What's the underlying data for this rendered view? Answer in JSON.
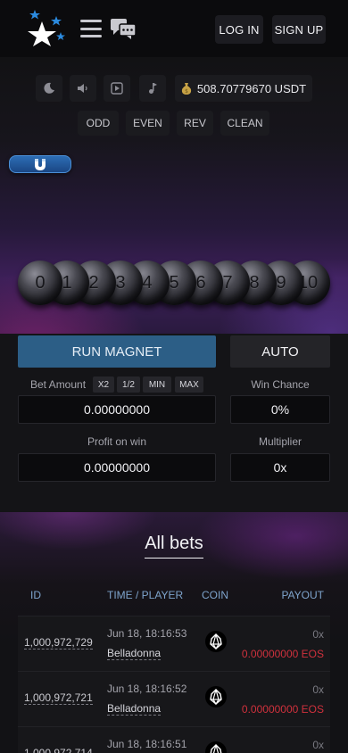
{
  "header": {
    "login_label": "LOG IN",
    "signup_label": "SIGN UP",
    "logo_icon": "stars-logo-icon",
    "menu_icon": "hamburger-icon",
    "chat_icon": "chat-bubbles-icon"
  },
  "game": {
    "controls": [
      {
        "name": "moon-icon"
      },
      {
        "name": "volume-icon"
      },
      {
        "name": "play-icon"
      },
      {
        "name": "music-note-icon"
      }
    ],
    "balance": "508.70779670 USDT",
    "pills": [
      "ODD",
      "EVEN",
      "REV",
      "CLEAN"
    ],
    "balls": [
      "0",
      "1",
      "2",
      "3",
      "4",
      "5",
      "6",
      "7",
      "8",
      "9",
      "10"
    ]
  },
  "panel": {
    "run_label": "RUN MAGNET",
    "auto_label": "AUTO",
    "bet_amount_label": "Bet Amount",
    "bet_buttons": [
      "X2",
      "1/2",
      "MIN",
      "MAX"
    ],
    "bet_amount": "0.00000000",
    "win_chance_label": "Win Chance",
    "win_chance": "0%",
    "profit_label": "Profit on win",
    "profit": "0.00000000",
    "multiplier_label": "Multiplier",
    "multiplier": "0x"
  },
  "bets": {
    "title": "All bets",
    "columns": [
      "ID",
      "TIME / PLAYER",
      "COIN",
      "PAYOUT"
    ],
    "rows": [
      {
        "id": "1,000,972,729",
        "time": "Jun 18, 18:16:53",
        "player": "Belladonna",
        "coin": "eos-icon",
        "mult": "0x",
        "payout": "0.00000000 EOS"
      },
      {
        "id": "1,000,972,721",
        "time": "Jun 18, 18:16:52",
        "player": "Belladonna",
        "coin": "eos-icon",
        "mult": "0x",
        "payout": "0.00000000 EOS"
      },
      {
        "id": "1,000,972,714",
        "time": "Jun 18, 18:16:51",
        "player": "",
        "coin": "eos-icon",
        "mult": "0x",
        "payout": ""
      }
    ]
  },
  "colors": {
    "accent_blue": "#2c5e86",
    "payout_red": "#d0313d",
    "header_blue": "#7ea4cc"
  }
}
